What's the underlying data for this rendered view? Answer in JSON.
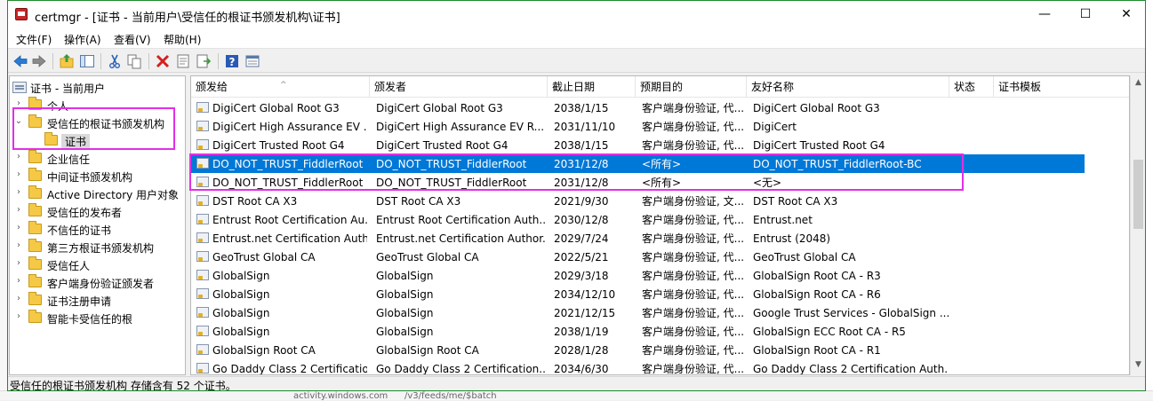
{
  "window": {
    "app_name": "certmgr",
    "title": "certmgr - [证书 - 当前用户\\受信任的根证书颁发机构\\证书]"
  },
  "title_buttons": {
    "minimize": "—",
    "maximize": "☐",
    "close": "✕"
  },
  "menu": [
    "文件(F)",
    "操作(A)",
    "查看(V)",
    "帮助(H)"
  ],
  "toolbar_icons": [
    "back-icon",
    "forward-icon",
    "up-folder-icon",
    "show-tree-icon",
    "cut-icon",
    "copy-icon",
    "delete-icon",
    "properties-icon",
    "export-icon",
    "help-icon",
    "view-icon"
  ],
  "tree": {
    "root": "证书 - 当前用户",
    "items": [
      {
        "label": "个人",
        "expanded": false
      },
      {
        "label": "受信任的根证书颁发机构",
        "expanded": true
      },
      {
        "label": "证书",
        "child": true,
        "selected": true
      },
      {
        "label": "企业信任",
        "expanded": false
      },
      {
        "label": "中间证书颁发机构",
        "expanded": false
      },
      {
        "label": "Active Directory 用户对象",
        "expanded": false
      },
      {
        "label": "受信任的发布者",
        "expanded": false
      },
      {
        "label": "不信任的证书",
        "expanded": false
      },
      {
        "label": "第三方根证书颁发机构",
        "expanded": false
      },
      {
        "label": "受信任人",
        "expanded": false
      },
      {
        "label": "客户端身份验证颁发者",
        "expanded": false
      },
      {
        "label": "证书注册申请",
        "expanded": false
      },
      {
        "label": "智能卡受信任的根",
        "expanded": false
      }
    ]
  },
  "columns": [
    "颁发给",
    "颁发者",
    "截止日期",
    "预期目的",
    "友好名称",
    "状态",
    "证书模板"
  ],
  "rows": [
    {
      "issued_to": "DigiCert Global Root G3",
      "issuer": "DigiCert Global Root G3",
      "expires": "2038/1/15",
      "purpose": "客户端身份验证, 代...",
      "friendly": "DigiCert Global Root G3"
    },
    {
      "issued_to": "DigiCert High Assurance EV ...",
      "issuer": "DigiCert High Assurance EV R...",
      "expires": "2031/11/10",
      "purpose": "客户端身份验证, 代...",
      "friendly": "DigiCert"
    },
    {
      "issued_to": "DigiCert Trusted Root G4",
      "issuer": "DigiCert Trusted Root G4",
      "expires": "2038/1/15",
      "purpose": "客户端身份验证, 代...",
      "friendly": "DigiCert Trusted Root G4"
    },
    {
      "issued_to": "DO_NOT_TRUST_FiddlerRoot",
      "issuer": "DO_NOT_TRUST_FiddlerRoot",
      "expires": "2031/12/8",
      "purpose": "<所有>",
      "friendly": "DO_NOT_TRUST_FiddlerRoot-BC",
      "selected": true
    },
    {
      "issued_to": "DO_NOT_TRUST_FiddlerRoot",
      "issuer": "DO_NOT_TRUST_FiddlerRoot",
      "expires": "2031/12/8",
      "purpose": "<所有>",
      "friendly": "<无>"
    },
    {
      "issued_to": "DST Root CA X3",
      "issuer": "DST Root CA X3",
      "expires": "2021/9/30",
      "purpose": "客户端身份验证, 文...",
      "friendly": "DST Root CA X3"
    },
    {
      "issued_to": "Entrust Root Certification Au...",
      "issuer": "Entrust Root Certification Auth...",
      "expires": "2030/12/8",
      "purpose": "客户端身份验证, 代...",
      "friendly": "Entrust.net"
    },
    {
      "issued_to": "Entrust.net Certification Auth...",
      "issuer": "Entrust.net Certification Author...",
      "expires": "2029/7/24",
      "purpose": "客户端身份验证, 代...",
      "friendly": "Entrust (2048)"
    },
    {
      "issued_to": "GeoTrust Global CA",
      "issuer": "GeoTrust Global CA",
      "expires": "2022/5/21",
      "purpose": "客户端身份验证, 代...",
      "friendly": "GeoTrust Global CA"
    },
    {
      "issued_to": "GlobalSign",
      "issuer": "GlobalSign",
      "expires": "2029/3/18",
      "purpose": "客户端身份验证, 代...",
      "friendly": "GlobalSign Root CA - R3"
    },
    {
      "issued_to": "GlobalSign",
      "issuer": "GlobalSign",
      "expires": "2034/12/10",
      "purpose": "客户端身份验证, 代...",
      "friendly": "GlobalSign Root CA - R6"
    },
    {
      "issued_to": "GlobalSign",
      "issuer": "GlobalSign",
      "expires": "2021/12/15",
      "purpose": "客户端身份验证, 代...",
      "friendly": "Google Trust Services - GlobalSign ..."
    },
    {
      "issued_to": "GlobalSign",
      "issuer": "GlobalSign",
      "expires": "2038/1/19",
      "purpose": "客户端身份验证, 代...",
      "friendly": "GlobalSign ECC Root CA - R5"
    },
    {
      "issued_to": "GlobalSign Root CA",
      "issuer": "GlobalSign Root CA",
      "expires": "2028/1/28",
      "purpose": "客户端身份验证, 代...",
      "friendly": "GlobalSign Root CA - R1"
    },
    {
      "issued_to": "Go Daddy Class 2 Certificatio...",
      "issuer": "Go Daddy Class 2 Certification...",
      "expires": "2034/6/30",
      "purpose": "客户端身份验证, 代...",
      "friendly": "Go Daddy Class 2 Certification Auth..."
    }
  ],
  "status": "受信任的根证书颁发机构 存储含有 52 个证书。",
  "background_fragments": [
    "activity.windows.com",
    "/v3/feeds/me/$batch"
  ],
  "colors": {
    "selection": "#0078d7",
    "highlight_box": "#e22fe6",
    "window_border": "#1e8b2a"
  }
}
